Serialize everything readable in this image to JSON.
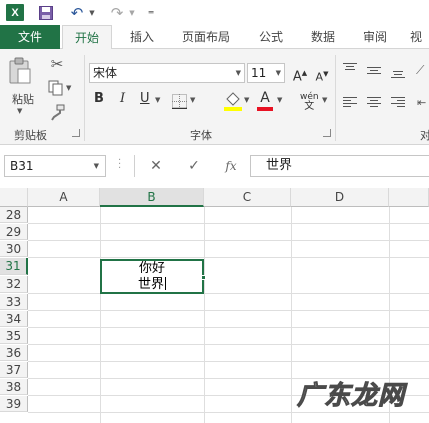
{
  "qat": {
    "app_logo": "X",
    "icons": [
      "excel-logo",
      "save-icon",
      "undo-icon",
      "redo-icon",
      "customize-qat-icon"
    ]
  },
  "tabs": [
    "文件",
    "开始",
    "插入",
    "页面布局",
    "公式",
    "数据",
    "审阅",
    "视"
  ],
  "active_tab": "开始",
  "ribbon": {
    "clipboard": {
      "paste_label": "粘贴",
      "group_label": "剪贴板"
    },
    "font": {
      "font_name": "宋体",
      "font_size": "11",
      "grow_label": "A",
      "shrink_label": "A",
      "bold_label": "B",
      "italic_label": "I",
      "underline_label": "U",
      "font_color_label": "A",
      "phonetic_top": "wén",
      "phonetic_bottom": "文",
      "group_label": "字体"
    },
    "alignment": {
      "group_label": "对"
    },
    "colors": {
      "font_color_bar": "#e81123",
      "fill_color_bar": "#ffff00"
    }
  },
  "formula_bar": {
    "name_box": "B31",
    "cancel": "✕",
    "enter": "✓",
    "insert_function": "fx",
    "content": "世界"
  },
  "grid": {
    "columns": [
      "A",
      "B",
      "C",
      "D",
      "E"
    ],
    "selected_column": "B",
    "rows": [
      "28",
      "29",
      "30",
      "31",
      "32",
      "33",
      "34",
      "35",
      "36",
      "37",
      "38",
      "39"
    ],
    "selected_row": "31",
    "active_cell": {
      "ref": "B31",
      "line1": "你好",
      "line2": "世界"
    }
  },
  "watermark": "广东龙网",
  "accent": "#217346"
}
